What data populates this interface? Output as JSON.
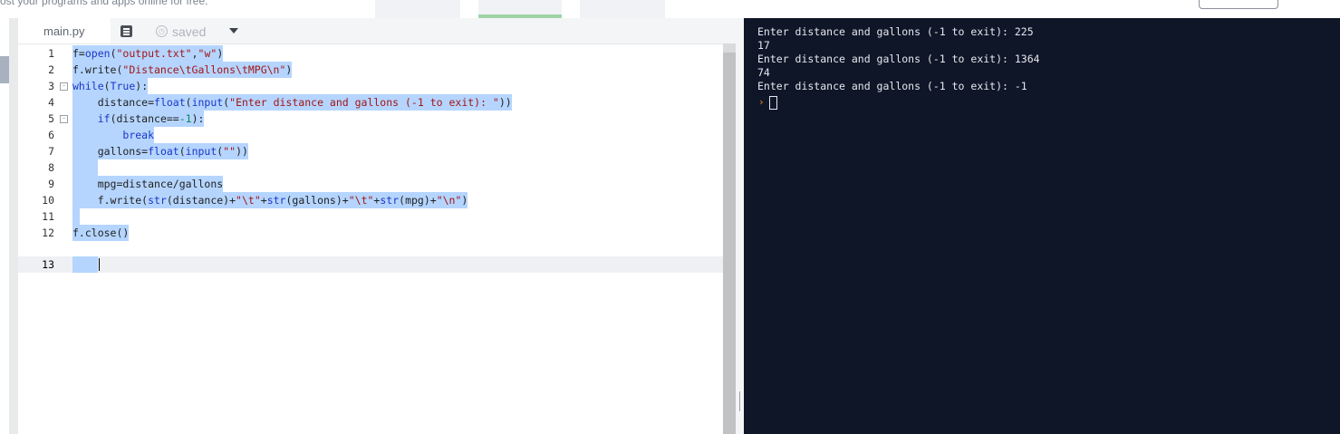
{
  "top": {
    "tagline": "ost your programs and apps online for free."
  },
  "editor": {
    "file_tab": "main.py",
    "saved_label": "saved",
    "line_numbers": [
      "1",
      "2",
      "3",
      "4",
      "5",
      "6",
      "7",
      "8",
      "9",
      "10",
      "11",
      "12",
      "13"
    ],
    "code": [
      "f=open(\"output.txt\",\"w\")",
      "f.write(\"Distance\\tGallons\\tMPG\\n\")",
      "while(True):",
      "    distance=float(input(\"Enter distance and gallons (-1 to exit): \"))",
      "    if(distance==-1):",
      "        break",
      "    gallons=float(input(\"\"))",
      "    ",
      "    mpg=distance/gallons",
      "    f.write(str(distance)+\"\\t\"+str(gallons)+\"\\t\"+str(mpg)+\"\\n\")",
      "",
      "f.close()",
      "    "
    ]
  },
  "console": {
    "lines": [
      "Enter distance and gallons (-1 to exit): 225",
      "17",
      "Enter distance and gallons (-1 to exit): 1364",
      "74",
      "Enter distance and gallons (-1 to exit): -1"
    ],
    "prompt_symbol": "›"
  },
  "colors": {
    "console_bg": "#0f1628",
    "selection": "#b5d5ff",
    "keyword": "#1a36c6",
    "string": "#a31515"
  }
}
